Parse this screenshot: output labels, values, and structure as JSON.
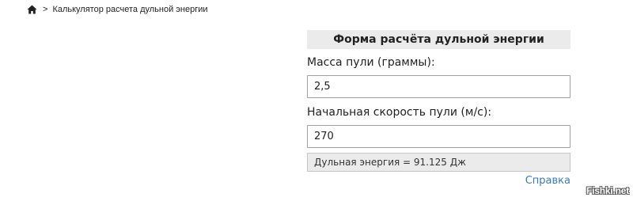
{
  "breadcrumb": {
    "home_icon": "home-icon",
    "separator": ">",
    "current": "Калькулятор расчета дульной энергии"
  },
  "form": {
    "title": "Форма расчёта дульной энергии",
    "mass_label": "Масса пули (граммы):",
    "mass_value": "2,5",
    "speed_label": "Начальная скорость пули (м/с):",
    "speed_value": "270",
    "result": "Дульная энергия = 91.125 Дж",
    "help_link": "Справка"
  },
  "watermark": "Fishki.net",
  "colors": {
    "panel_bg": "#ebebeb",
    "link": "#3a7bbf",
    "text": "#222222"
  }
}
